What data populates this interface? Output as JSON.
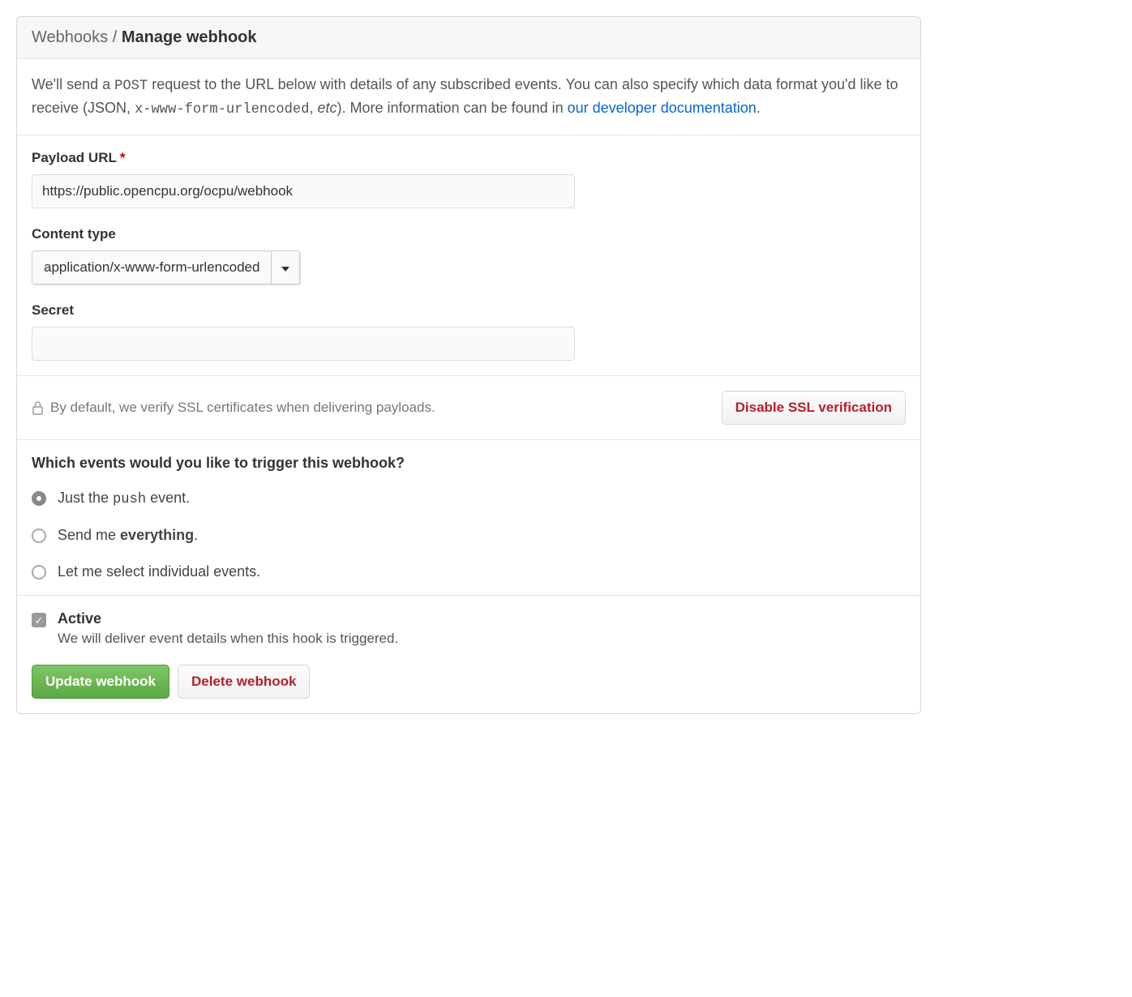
{
  "breadcrumb": {
    "parent": "Webhooks",
    "separator": "/",
    "current": "Manage webhook"
  },
  "intro": {
    "part1": "We'll send a ",
    "code_post": "POST",
    "part2": " request to the URL below with details of any subscribed events. You can also specify which data format you'd like to receive (JSON, ",
    "code_ctype": "x-www-form-urlencoded",
    "part3": ", ",
    "etc": "etc",
    "part4": "). More information can be found in ",
    "link_text": "our developer documentation",
    "part5": "."
  },
  "form": {
    "payload_url": {
      "label": "Payload URL",
      "required": "*",
      "value": "https://public.opencpu.org/ocpu/webhook"
    },
    "content_type": {
      "label": "Content type",
      "selected": "application/x-www-form-urlencoded"
    },
    "secret": {
      "label": "Secret",
      "value": ""
    }
  },
  "ssl": {
    "text": "By default, we verify SSL certificates when delivering payloads.",
    "button": "Disable SSL verification"
  },
  "events": {
    "title": "Which events would you like to trigger this webhook?",
    "opt1_pre": "Just the ",
    "opt1_code": "push",
    "opt1_post": " event.",
    "opt2_pre": "Send me ",
    "opt2_bold": "everything",
    "opt2_post": ".",
    "opt3": "Let me select individual events."
  },
  "active": {
    "label": "Active",
    "description": "We will deliver event details when this hook is triggered."
  },
  "buttons": {
    "update": "Update webhook",
    "delete": "Delete webhook"
  }
}
